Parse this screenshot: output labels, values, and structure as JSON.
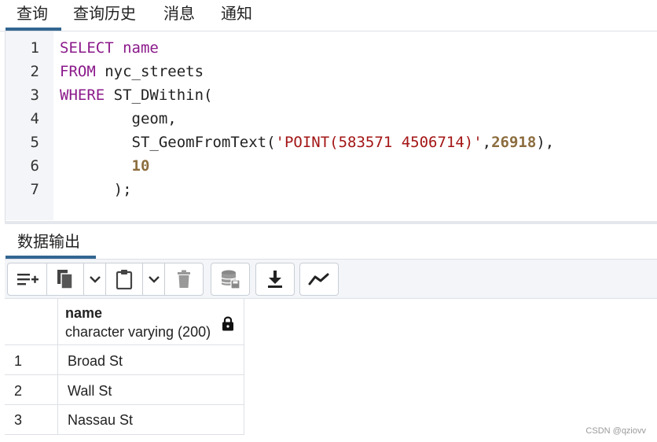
{
  "tabs": [
    {
      "label": "查询"
    },
    {
      "label": "查询历史"
    },
    {
      "label": "消息"
    },
    {
      "label": "通知"
    }
  ],
  "editor": {
    "line_numbers": [
      "1",
      "2",
      "3",
      "4",
      "5",
      "6",
      "7"
    ],
    "lines": [
      [
        {
          "t": "kw",
          "v": "SELECT"
        },
        {
          "t": "id",
          "v": " "
        },
        {
          "t": "kw",
          "v": "name"
        }
      ],
      [
        {
          "t": "kw",
          "v": "FROM"
        },
        {
          "t": "id",
          "v": " nyc_streets"
        }
      ],
      [
        {
          "t": "kw",
          "v": "WHERE"
        },
        {
          "t": "id",
          "v": " ST_DWithin("
        }
      ],
      [
        {
          "t": "id",
          "v": "        geom,"
        }
      ],
      [
        {
          "t": "id",
          "v": "        ST_GeomFromText("
        },
        {
          "t": "str",
          "v": "'POINT(583571 4506714)'"
        },
        {
          "t": "id",
          "v": ","
        },
        {
          "t": "num",
          "v": "26918"
        },
        {
          "t": "id",
          "v": "),"
        }
      ],
      [
        {
          "t": "id",
          "v": "        "
        },
        {
          "t": "num",
          "v": "10"
        }
      ],
      [
        {
          "t": "id",
          "v": "      );"
        }
      ]
    ]
  },
  "output": {
    "tab_label": "数据输出",
    "toolbar_icons": [
      "add-row-icon",
      "copy-icon",
      "chevron-down-icon",
      "paste-icon",
      "chevron-down-icon",
      "delete-icon",
      "save-data-icon",
      "download-icon",
      "graph-icon"
    ],
    "column": {
      "name": "name",
      "type": "character varying (200)",
      "locked": true
    },
    "rows": [
      {
        "num": "1",
        "value": "Broad St"
      },
      {
        "num": "2",
        "value": "Wall St"
      },
      {
        "num": "3",
        "value": "Nassau St"
      }
    ]
  },
  "watermark": "CSDN @qziovv",
  "colors": {
    "accent": "#326690",
    "keyword": "#8b1a8b",
    "string": "#a31515",
    "number": "#8c6d3e"
  }
}
